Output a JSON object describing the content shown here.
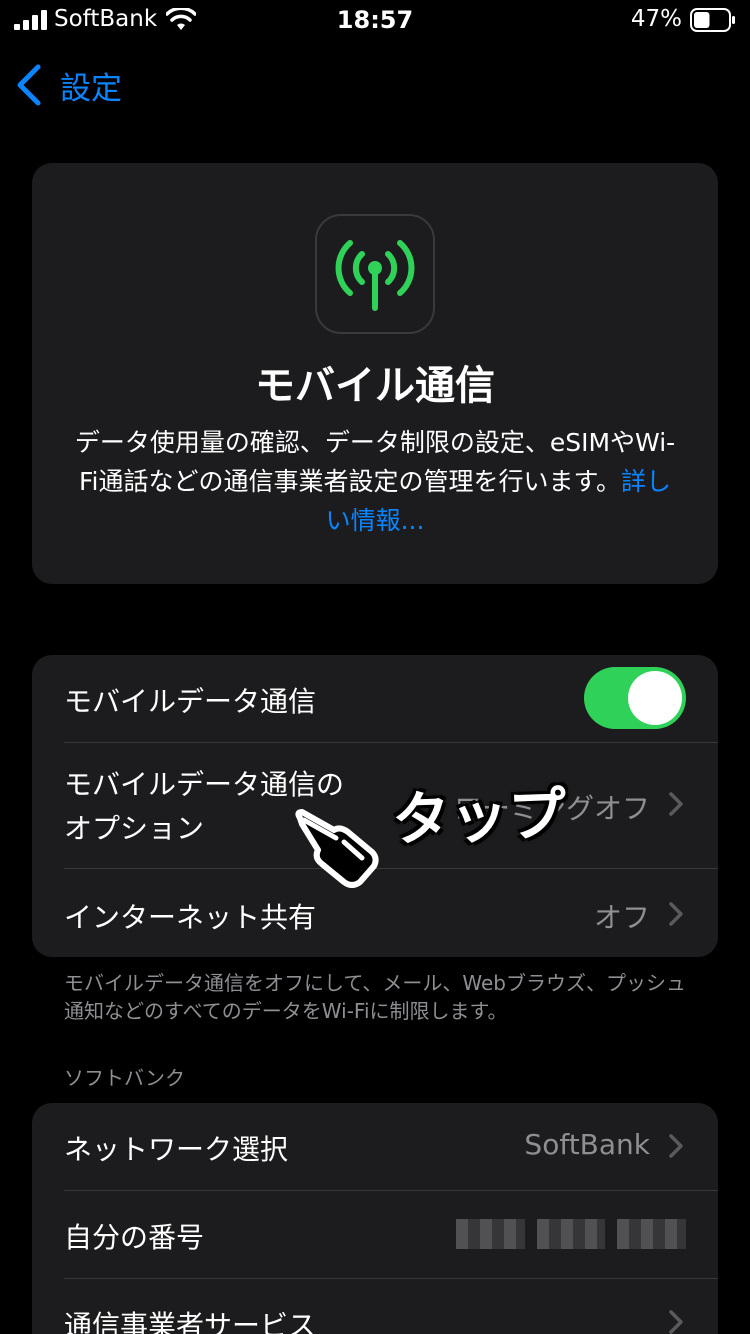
{
  "status_bar": {
    "carrier": "SoftBank",
    "time": "18:57",
    "battery_percent": "47%",
    "battery_level": 0.47
  },
  "nav": {
    "back_label": "設定"
  },
  "hero": {
    "icon": "antenna-icon",
    "title": "モバイル通信",
    "description": "データ使用量の確認、データ制限の設定、eSIMやWi-Fi通話などの通信事業者設定の管理を行います。",
    "link": "詳しい情報..."
  },
  "mobile_group": {
    "rows": [
      {
        "label": "モバイルデータ通信",
        "toggle_on": true
      },
      {
        "label_line1": "モバイルデータ通信の",
        "label_line2": "オプション",
        "value": "ローミングオフ"
      },
      {
        "label": "インターネット共有",
        "value": "オフ"
      }
    ],
    "footer": "モバイルデータ通信をオフにして、メール、Webブラウズ、プッシュ通知などのすべてのデータをWi-Fiに制限します。"
  },
  "carrier_group": {
    "header": "ソフトバンク",
    "rows": [
      {
        "label": "ネットワーク選択",
        "value": "SoftBank"
      },
      {
        "label": "自分の番号"
      },
      {
        "label": "通信事業者サービス"
      }
    ]
  },
  "annotation": {
    "text": "タップ"
  },
  "colors": {
    "accent": "#0a84ff",
    "toggle_on": "#30d158",
    "card": "#1c1c1e",
    "secondary_text": "#8e8e93"
  }
}
